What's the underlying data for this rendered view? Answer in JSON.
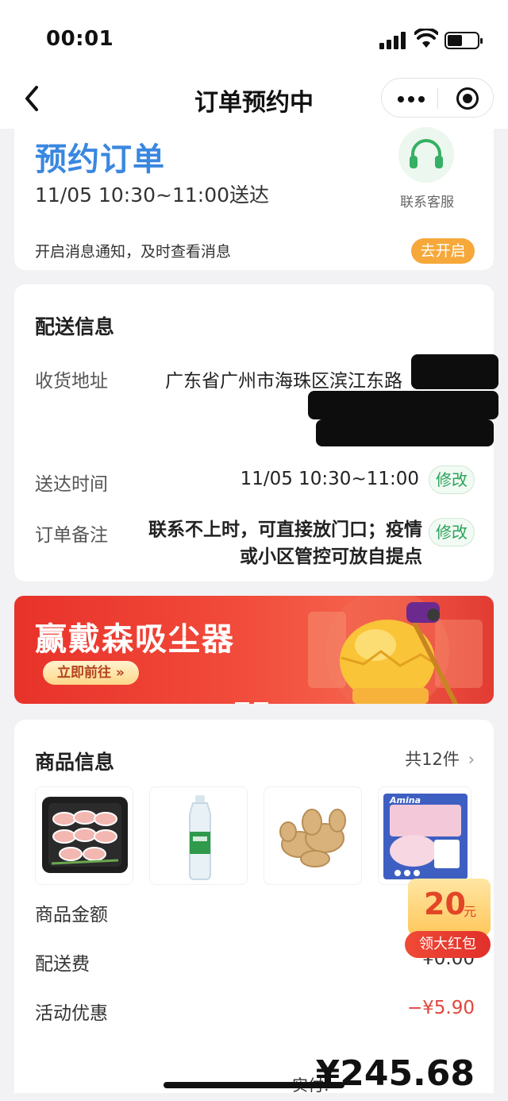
{
  "status_bar": {
    "time": "00:01"
  },
  "nav": {
    "title": "订单预约中"
  },
  "order": {
    "type": "预约订单",
    "delivery_window": "11/05 10:30~11:00送达",
    "service_label": "联系客服",
    "notify_text": "开启消息通知，及时查看消息",
    "notify_button": "去开启"
  },
  "delivery": {
    "title": "配送信息",
    "address_label": "收货地址",
    "address_value": "广东省广州市海珠区滨江东路",
    "time_label": "送达时间",
    "time_value": "11/05 10:30~11:00",
    "remark_label": "订单备注",
    "remark_value": "联系不上时，可直接放门口；疫情或小区管控可放自提点",
    "edit_label": "修改"
  },
  "banner": {
    "title": "赢戴森吸尘器",
    "cta": "立即前往 »"
  },
  "goods": {
    "title": "商品信息",
    "count": "共12件",
    "thumbnail_brand": "Amina",
    "prices": [
      {
        "label": "商品金额",
        "value": ""
      },
      {
        "label": "配送费",
        "value": "¥0.00"
      },
      {
        "label": "活动优惠",
        "value": "−¥5.90"
      }
    ],
    "total_label": "实付:",
    "total_value": "¥245.68"
  },
  "redpacket": {
    "amount": "20",
    "unit": "元",
    "label": "领大红包"
  },
  "colors": {
    "accent": "#3a87e0",
    "green": "#2aa35a",
    "orange": "#f6a83a",
    "red": "#e0463c"
  }
}
